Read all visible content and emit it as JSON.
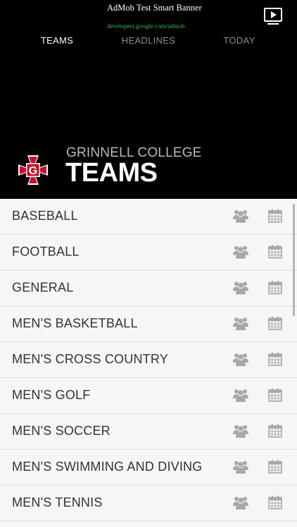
{
  "ad": {
    "title": "AdMob Test Smart Banner",
    "url": "developers.google.com/admob",
    "icon": "play-video-icon"
  },
  "tabs": [
    {
      "label": "TEAMS",
      "active": true
    },
    {
      "label": "HEADLINES",
      "active": false
    },
    {
      "label": "TODAY",
      "active": false
    }
  ],
  "header": {
    "subtitle": "GRINNELL COLLEGE",
    "title": "TEAMS",
    "logo_icon": "grinnell-g-logo"
  },
  "colors": {
    "background": "#000000",
    "list_background": "#f6f6f6",
    "accent_red": "#c8102e",
    "icon_gray": "#a8a8a8"
  },
  "teams": [
    {
      "name": "BASEBALL"
    },
    {
      "name": "FOOTBALL"
    },
    {
      "name": "GENERAL"
    },
    {
      "name": "MEN'S BASKETBALL"
    },
    {
      "name": "MEN'S CROSS COUNTRY"
    },
    {
      "name": "MEN'S GOLF"
    },
    {
      "name": "MEN'S SOCCER"
    },
    {
      "name": "MEN'S SWIMMING AND DIVING"
    },
    {
      "name": "MEN'S TENNIS"
    }
  ],
  "row_icons": {
    "roster": "roster-people-icon",
    "schedule": "calendar-icon"
  }
}
